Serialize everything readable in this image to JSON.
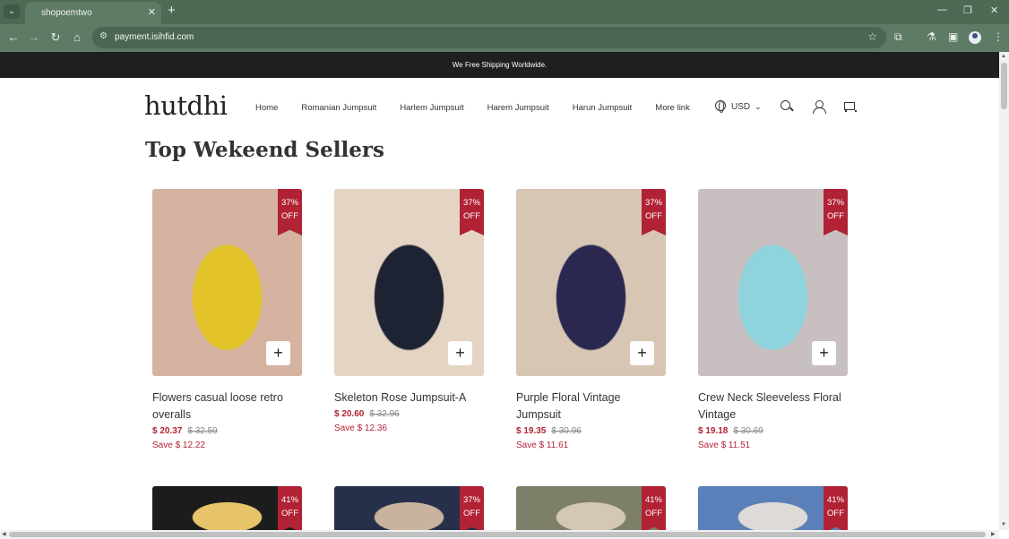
{
  "browser": {
    "tab_title": "shopoemtwo",
    "url": "payment.isihfid.com",
    "icons": [
      "tab-list-icon",
      "close-tab-icon",
      "new-tab-icon",
      "minimize-icon",
      "restore-icon",
      "close-window-icon",
      "back-icon",
      "forward-icon",
      "reload-icon",
      "home-icon",
      "site-info-icon",
      "bookmark-star-icon",
      "extensions-icon",
      "labs-icon",
      "sidebar-icon",
      "profile-icon",
      "menu-icon"
    ]
  },
  "announcement": "We Free Shipping Worldwide.",
  "header": {
    "logo": "hutdhi",
    "nav": [
      "Home",
      "Romanian Jumpsuit",
      "Harlem Jumpsuit",
      "Harem Jumpsuit",
      "Harun Jumpsuit",
      "More link"
    ],
    "currency": "USD"
  },
  "section_title": "Top Wekeend Sellers",
  "products": [
    {
      "name": "Flowers casual loose retro overalls",
      "price": "$ 20.37",
      "old_price": "$ 32.59",
      "save": "Save $ 12.22",
      "badge_pct": "37%",
      "badge_off": "OFF",
      "colors": [
        "#e2c32a",
        "#e8702a",
        "#d5b3a0"
      ]
    },
    {
      "name": "Skeleton Rose Jumpsuit-A",
      "price": "$ 20.60",
      "old_price": "$ 32.96",
      "save": "Save $ 12.36",
      "badge_pct": "37%",
      "badge_off": "OFF",
      "colors": [
        "#1d2333",
        "#b0242e",
        "#e4d4c4"
      ]
    },
    {
      "name": "Purple Floral Vintage Jumpsuit",
      "price": "$ 19.35",
      "old_price": "$ 30.96",
      "save": "Save $ 11.61",
      "badge_pct": "37%",
      "badge_off": "OFF",
      "colors": [
        "#2a2750",
        "#7f4fa0",
        "#d7c6b4"
      ]
    },
    {
      "name": "Crew Neck Sleeveless Floral Vintage",
      "price": "$ 19.18",
      "old_price": "$ 30.69",
      "save": "Save $ 11.51",
      "badge_pct": "37%",
      "badge_off": "OFF",
      "colors": [
        "#8fd3dc",
        "#e75aa0",
        "#c8c0c0"
      ]
    }
  ],
  "products_row2": [
    {
      "badge_pct": "41%",
      "badge_off": "OFF",
      "colors": [
        "#e7c46a",
        "#1c1c1c"
      ]
    },
    {
      "badge_pct": "37%",
      "badge_off": "OFF",
      "colors": [
        "#c9b39e",
        "#27304a"
      ]
    },
    {
      "badge_pct": "41%",
      "badge_off": "OFF",
      "colors": [
        "#d4c7b4",
        "#7d7f69"
      ]
    },
    {
      "badge_pct": "41%",
      "badge_off": "OFF",
      "colors": [
        "#dedad8",
        "#5b7fb8"
      ]
    }
  ],
  "add_label": "+"
}
